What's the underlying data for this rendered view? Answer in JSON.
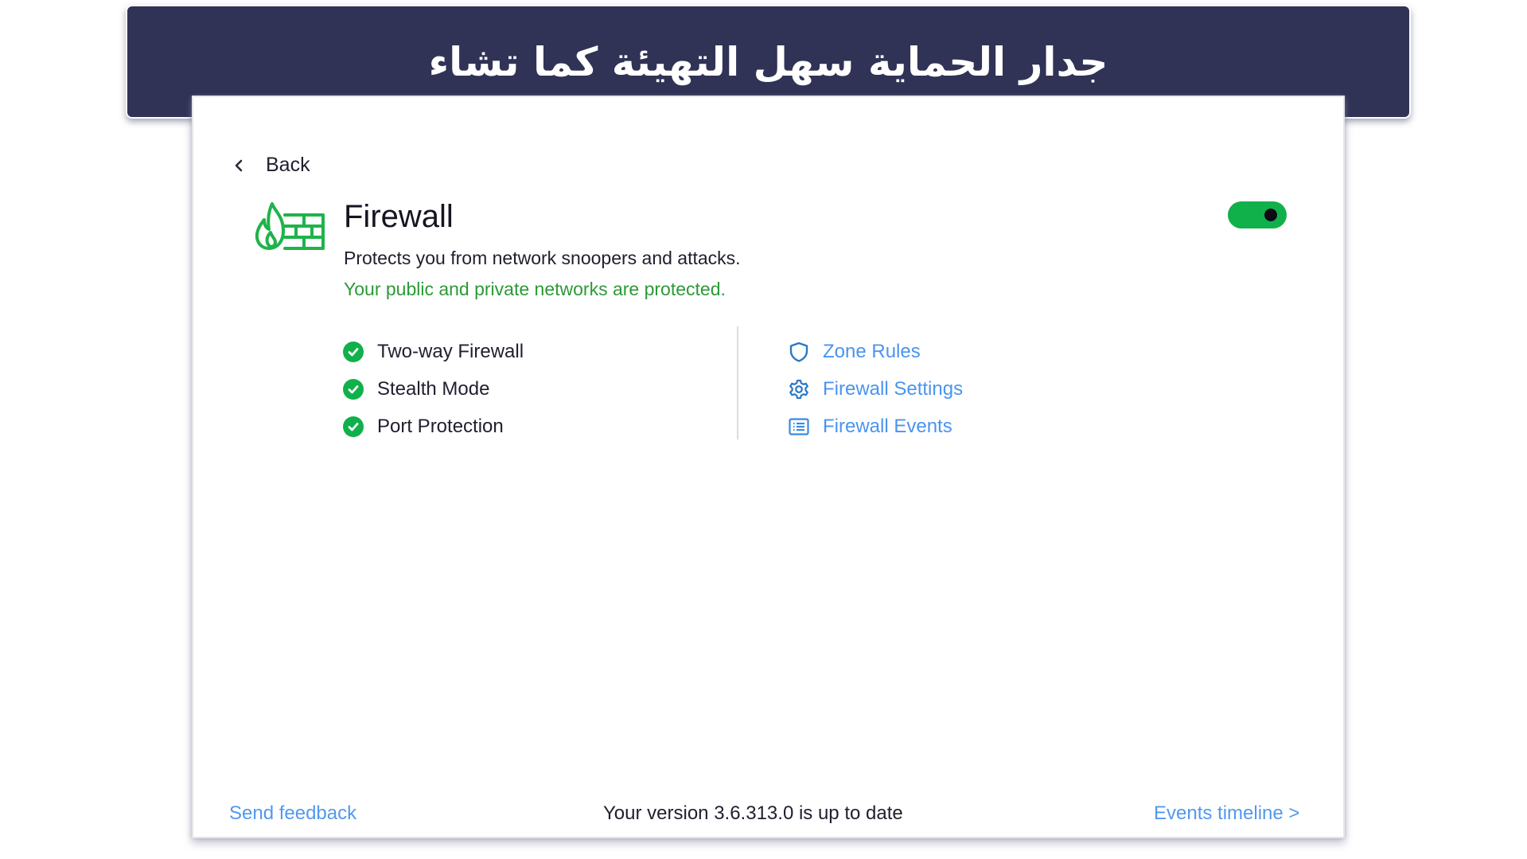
{
  "banner": {
    "title": "جدار الحماية سهل التهيئة كما تشاء"
  },
  "nav": {
    "back_label": "Back"
  },
  "header": {
    "title": "Firewall",
    "description": "Protects you from network snoopers and attacks.",
    "status": "Your public and private networks are protected.",
    "toggle_on": true
  },
  "features": [
    {
      "label": "Two-way Firewall",
      "icon": "check-circle-icon",
      "enabled": true
    },
    {
      "label": "Stealth Mode",
      "icon": "check-circle-icon",
      "enabled": true
    },
    {
      "label": "Port Protection",
      "icon": "check-circle-icon",
      "enabled": true
    }
  ],
  "links": [
    {
      "label": "Zone Rules",
      "icon": "shield-icon"
    },
    {
      "label": "Firewall Settings",
      "icon": "gear-icon"
    },
    {
      "label": "Firewall Events",
      "icon": "list-icon"
    }
  ],
  "footer": {
    "feedback_label": "Send feedback",
    "version_text": "Your version 3.6.313.0 is up to date",
    "timeline_label": "Events timeline >"
  },
  "colors": {
    "banner_bg": "#303256",
    "accent_green": "#10b04a",
    "status_green": "#2b9a36",
    "link_blue": "#4a94ee",
    "icon_blue": "#2a78c8"
  }
}
